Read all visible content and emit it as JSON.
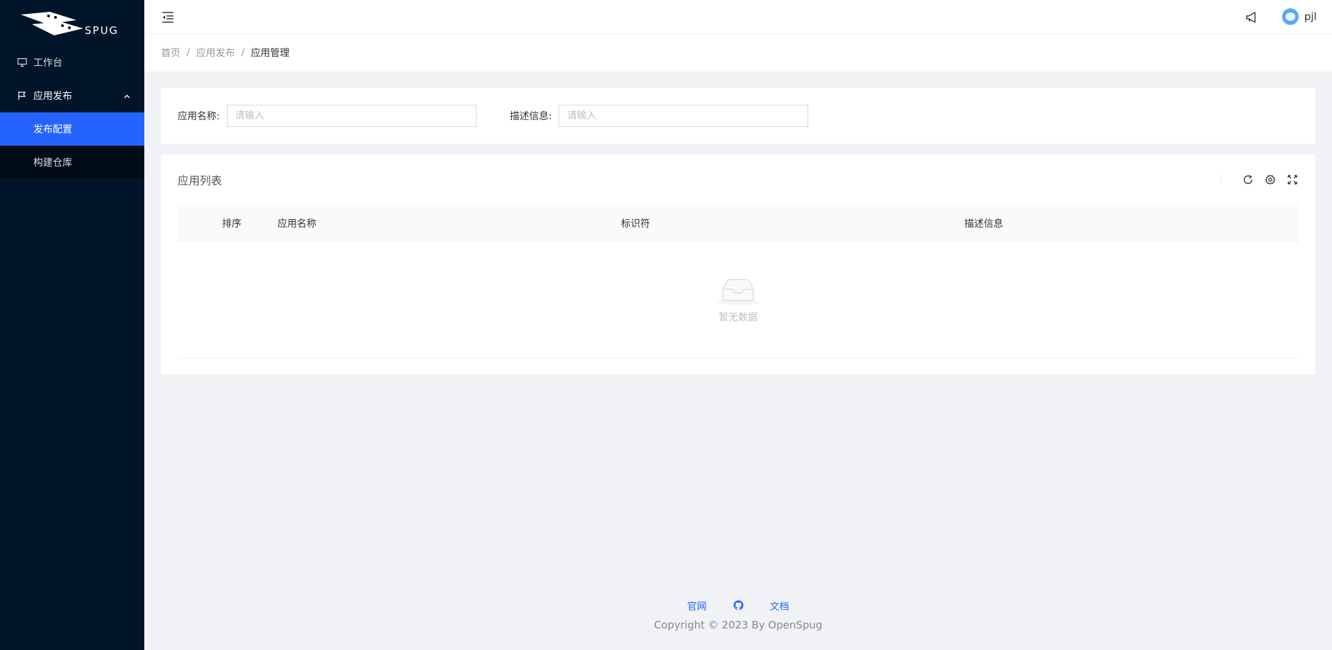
{
  "brand": {
    "logo_text": "SPUG"
  },
  "sidebar": {
    "items": [
      {
        "label": "工作台",
        "icon": "desktop-icon"
      },
      {
        "label": "应用发布",
        "icon": "flag-icon",
        "expanded": true,
        "children": [
          {
            "label": "发布配置",
            "active": true
          },
          {
            "label": "构建仓库",
            "active": false
          }
        ]
      }
    ]
  },
  "header": {
    "username": "pjl"
  },
  "breadcrumb": {
    "items": [
      "首页",
      "应用发布",
      "应用管理"
    ],
    "separator": "/"
  },
  "search": {
    "name_label": "应用名称:",
    "name_placeholder": "请输入",
    "desc_label": "描述信息:",
    "desc_placeholder": "请输入"
  },
  "table": {
    "title": "应用列表",
    "columns": [
      "排序",
      "应用名称",
      "标识符",
      "描述信息"
    ],
    "rows": [],
    "empty_text": "暂无数据"
  },
  "footer": {
    "links": [
      "官网",
      "文档"
    ],
    "copyright": "Copyright © 2023 By OpenSpug"
  },
  "colors": {
    "sidebar_bg": "#001529",
    "submenu_bg": "#000c17",
    "active_item": "#2563ff",
    "page_bg": "#f0f2f5",
    "link": "#2563ff"
  }
}
